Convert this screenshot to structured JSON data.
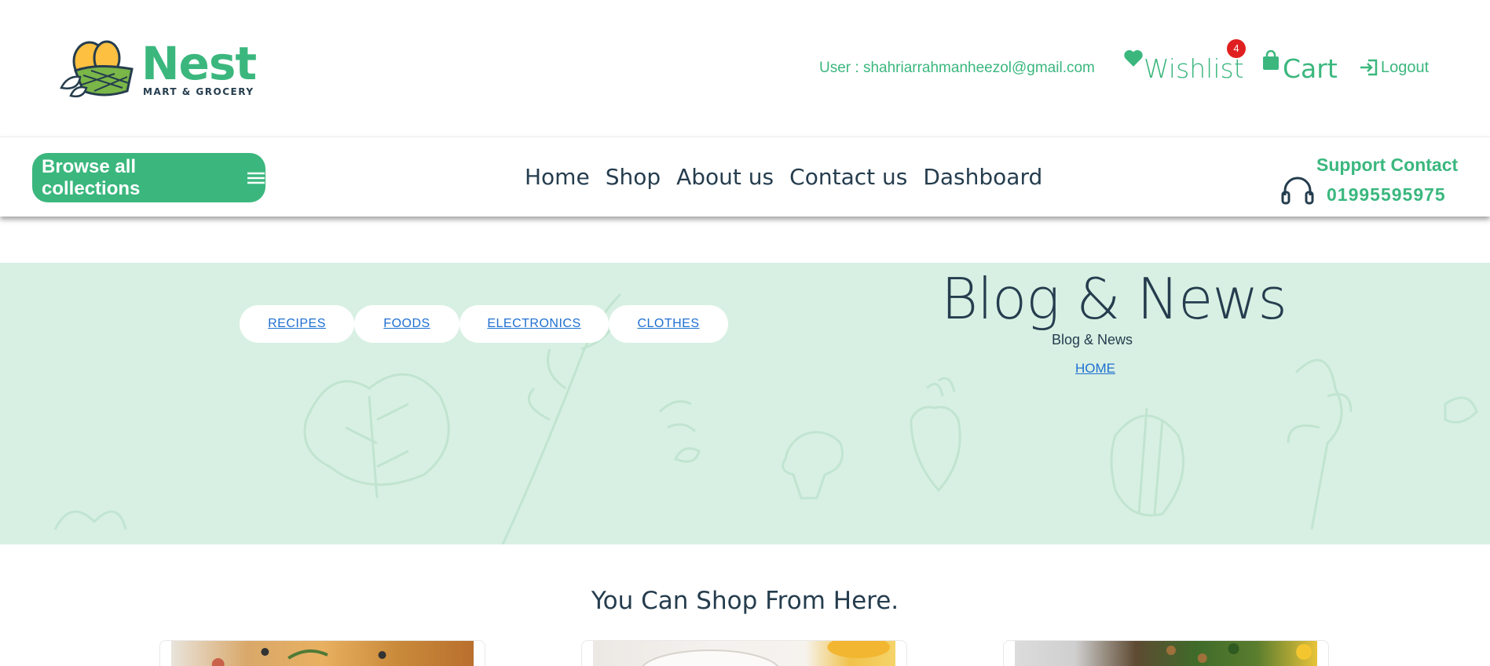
{
  "header": {
    "logo": {
      "name": "Nest",
      "subtitle": "MART & GROCERY"
    },
    "user_label": "User : shahriarrahmanheezol@gmail.com",
    "wishlist": {
      "label": "Wishlist",
      "count": "4"
    },
    "cart": {
      "label": "Cart"
    },
    "logout": {
      "label": "Logout"
    }
  },
  "nav": {
    "browse_label": "Browse all collections",
    "links": [
      "Home",
      "Shop",
      "About us",
      "Contact us",
      "Dashboard"
    ],
    "support": {
      "title": "Support Contact",
      "phone": "01995595975"
    }
  },
  "hero": {
    "categories": [
      "RECIPES",
      "FOODS",
      "ELECTRONICS",
      "CLOTHES"
    ],
    "title": "Blog & News",
    "subtitle": "Blog & News",
    "breadcrumb_home": "HOME"
  },
  "shop": {
    "heading": "You Can Shop From Here.",
    "cards": [
      {
        "image": "pizza-image"
      },
      {
        "image": "plate-image"
      },
      {
        "image": "salad-image"
      }
    ]
  },
  "colors": {
    "brand": "#3bb77e",
    "text": "#253d4e",
    "hero_bg": "#d8f0e3",
    "link": "#1f6fd1",
    "badge": "#e02020"
  }
}
